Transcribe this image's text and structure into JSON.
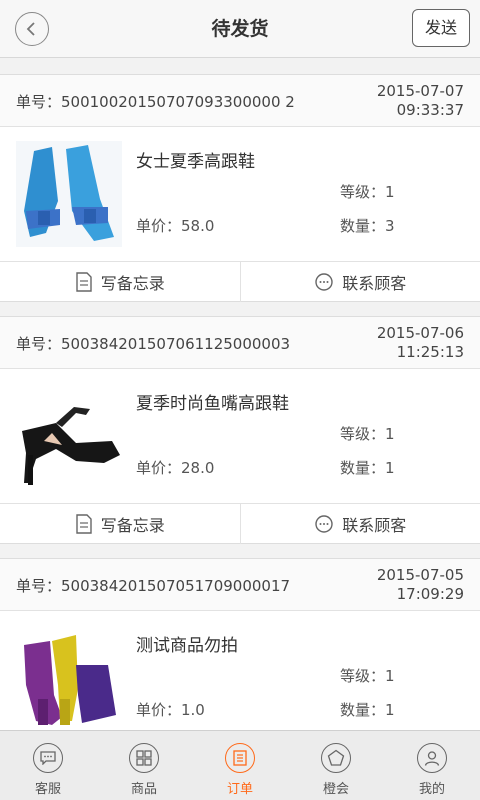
{
  "header": {
    "title": "待发货",
    "send_label": "发送"
  },
  "orders": [
    {
      "order_no": "单号：50010020150707093300000 2",
      "date": "2015-07-07",
      "time": "09:33:37",
      "product": "女士夏季高跟鞋",
      "grade": "等级：1",
      "price": "单价：58.0",
      "qty": "数量：3",
      "memo": "写备忘录",
      "contact": "联系顾客"
    },
    {
      "order_no": "单号：500384201507061125000003",
      "date": "2015-07-06",
      "time": "11:25:13",
      "product": "夏季时尚鱼嘴高跟鞋",
      "grade": "等级：1",
      "price": "单价：28.0",
      "qty": "数量：1",
      "memo": "写备忘录",
      "contact": "联系顾客"
    },
    {
      "order_no": "单号：500384201507051709000017",
      "date": "2015-07-05",
      "time": "17:09:29",
      "product": "测试商品勿拍",
      "grade": "等级：1",
      "price": "单价：1.0",
      "qty": "数量：1"
    }
  ],
  "tabs": [
    {
      "label": "客服",
      "icon": "chat-icon"
    },
    {
      "label": "商品",
      "icon": "grid-icon"
    },
    {
      "label": "订单",
      "icon": "document-icon",
      "active": true
    },
    {
      "label": "橙会",
      "icon": "pentagon-icon"
    },
    {
      "label": "我的",
      "icon": "person-icon"
    }
  ],
  "colors": {
    "accent": "#ff6a1a"
  }
}
